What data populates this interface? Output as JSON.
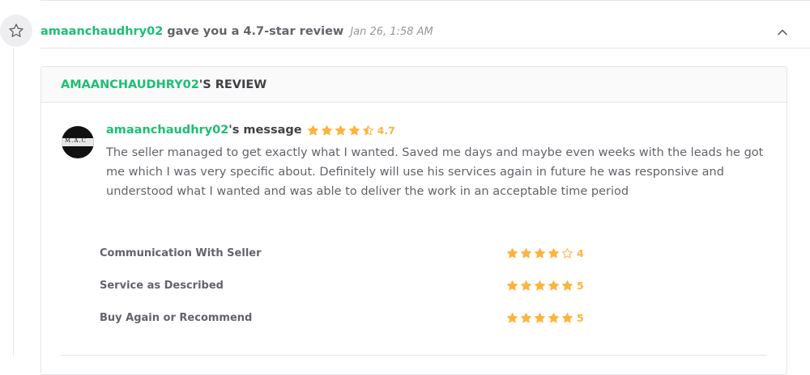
{
  "activity": {
    "icon": "star-outline-icon",
    "username": "amaanchaudhry02",
    "action_text": "gave you a 4.7-star review",
    "timestamp": "Jan 26, 1:58 AM",
    "collapse_icon": "chevron-up-icon"
  },
  "review_card": {
    "title_user": "AMAANCHAUDHRY02",
    "title_suffix": "'S REVIEW",
    "avatar_text": "M.A.C",
    "message": {
      "username": "amaanchaudhry02",
      "suffix": "'s message",
      "rating": 4.7,
      "rating_label": "4.7",
      "body": "The seller managed to get exactly what I wanted. Saved me days and maybe even weeks with the leads he got me which I was very specific about. Definitely will use his services again in future he was responsive and understood what I wanted and was able to deliver the work in an acceptable time period"
    },
    "ratings": [
      {
        "label": "Communication With Seller",
        "value": 4,
        "value_label": "4"
      },
      {
        "label": "Service as Described",
        "value": 5,
        "value_label": "5"
      },
      {
        "label": "Buy Again or Recommend",
        "value": 5,
        "value_label": "5"
      }
    ]
  },
  "colors": {
    "accent_green": "#1dbf73",
    "star_gold": "#ffb33e",
    "text_dark": "#404145",
    "text_gray": "#62646a"
  }
}
